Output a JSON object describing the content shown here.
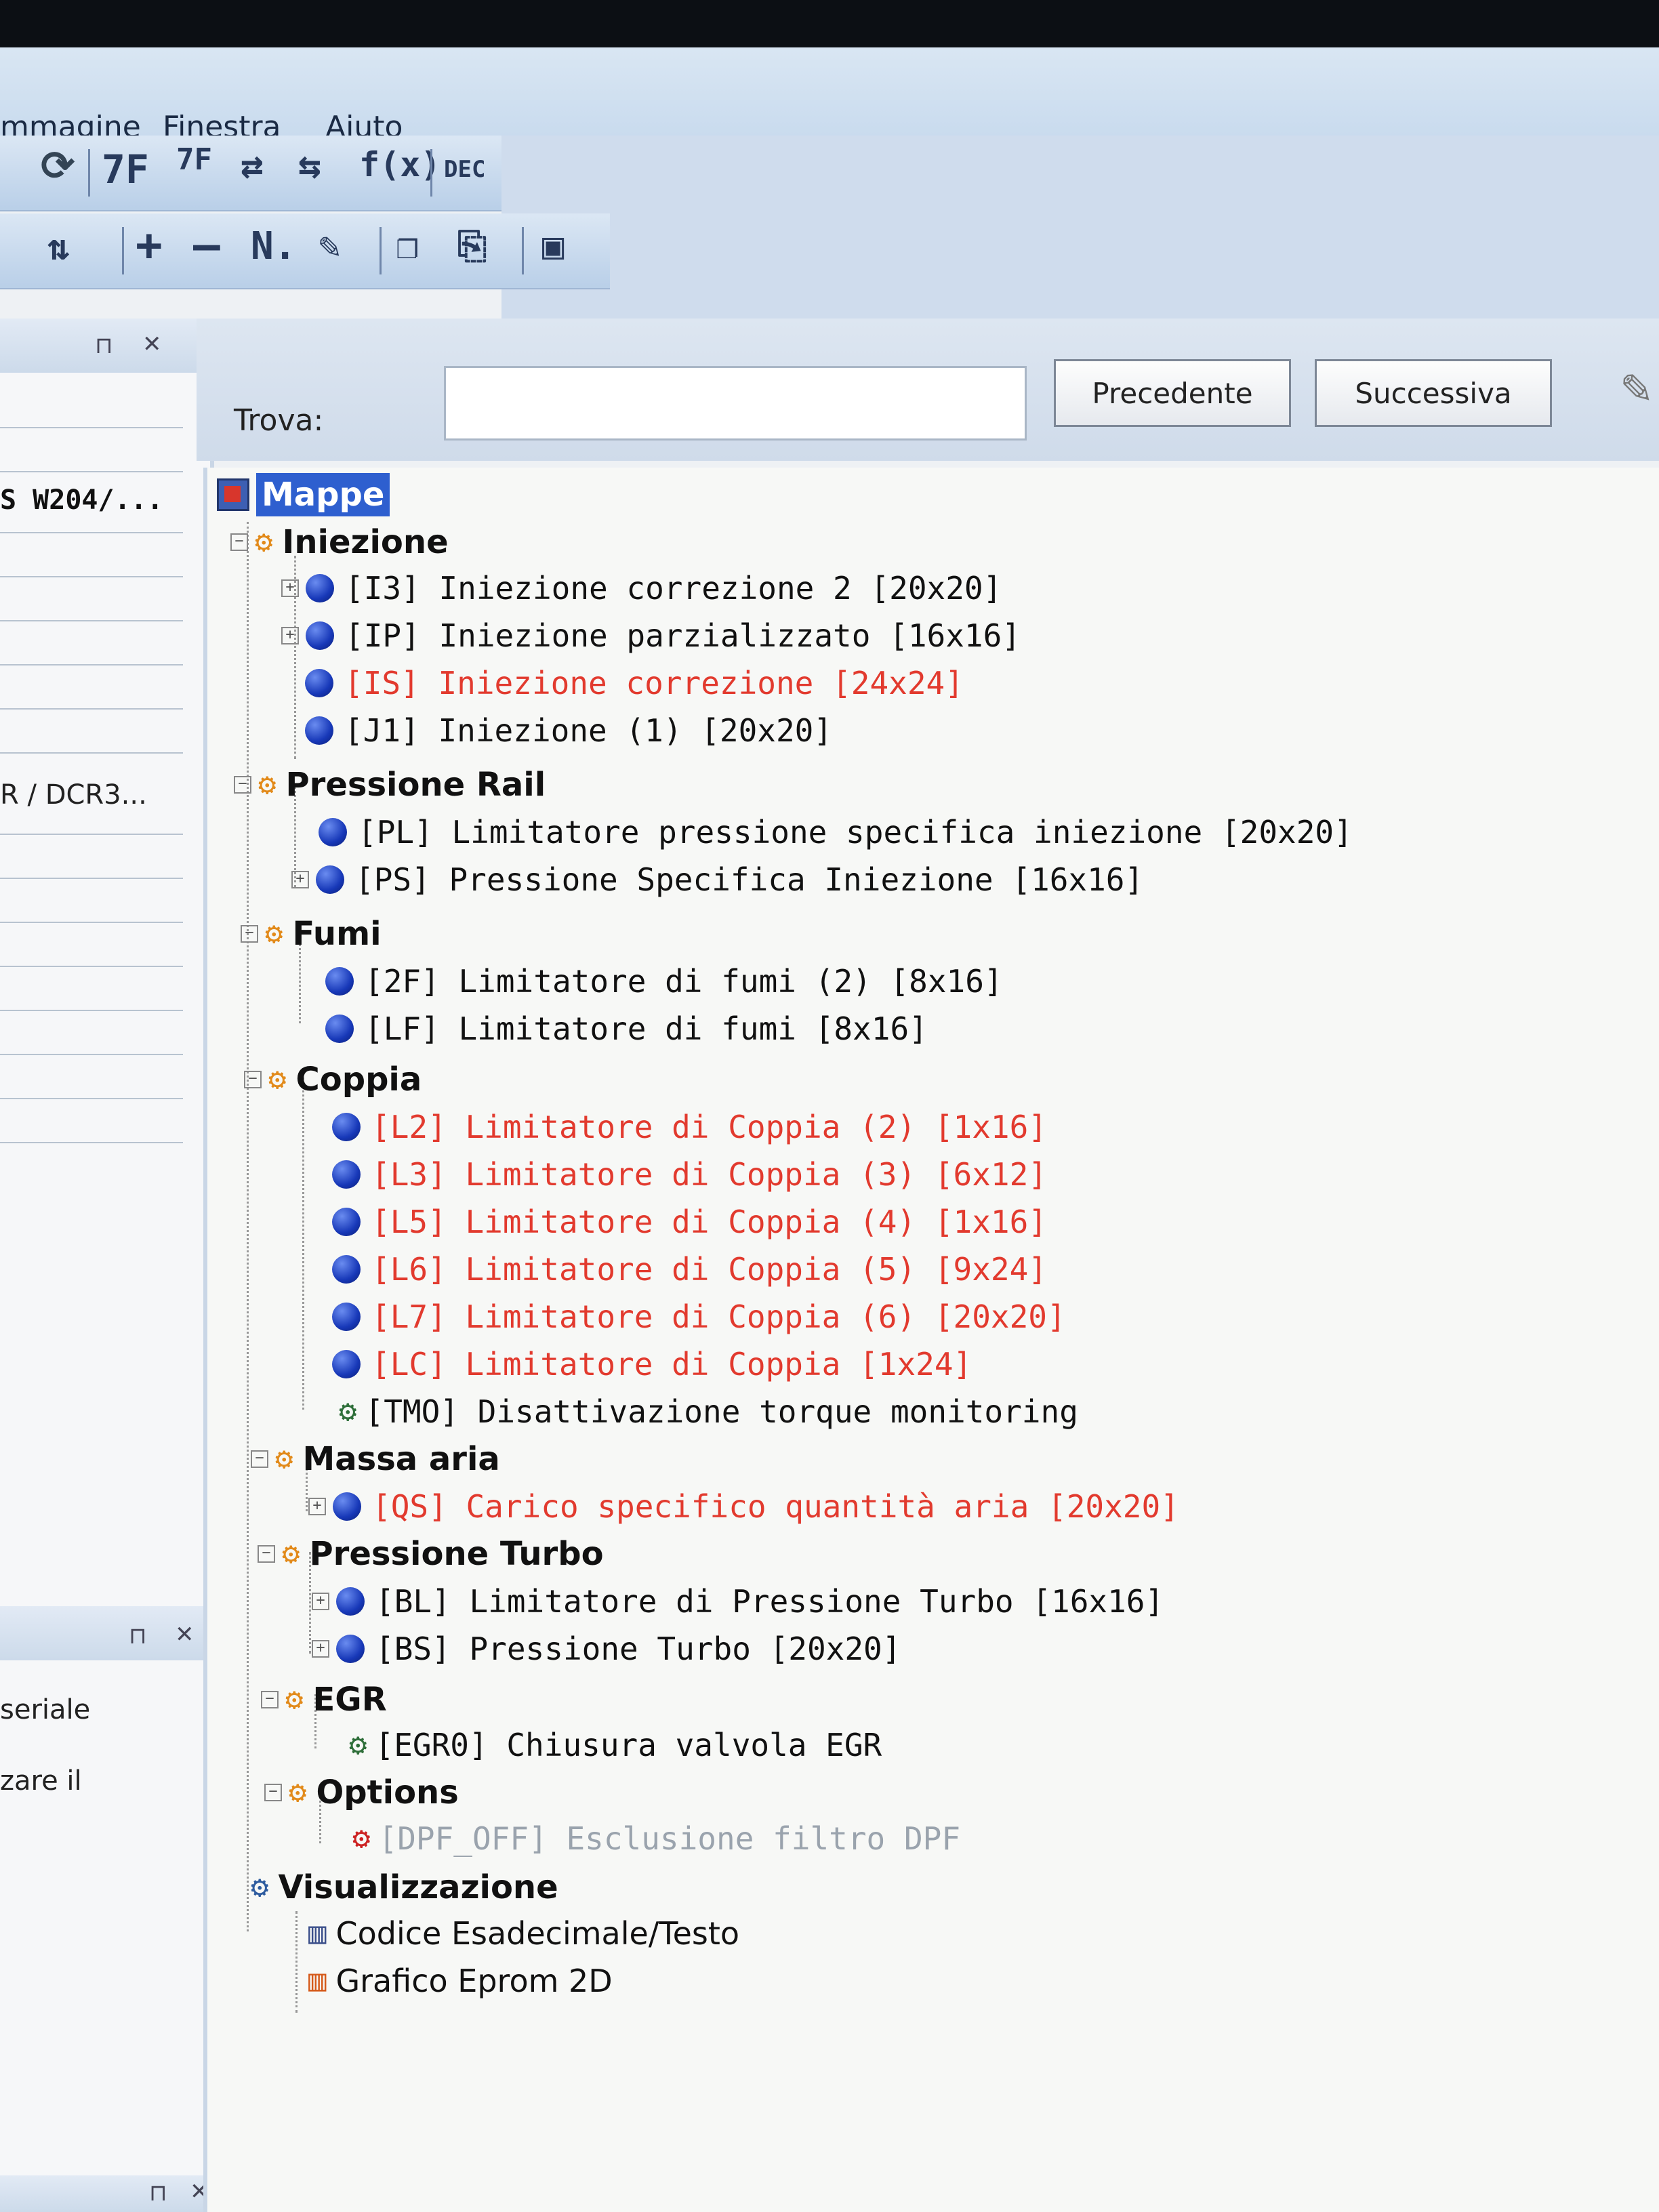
{
  "menu": {
    "items": [
      "mmagine",
      "Finestra",
      "Aiuto"
    ]
  },
  "toolbar1": {
    "labels": [
      "7F",
      "7F",
      "DEC"
    ]
  },
  "toolbar2": {
    "labels": [
      "+",
      "—",
      "N."
    ]
  },
  "left_panel": {
    "lines": [
      "S W204/...",
      "R / DCR3..."
    ],
    "bottom_text": [
      "seriale",
      "zare il"
    ]
  },
  "find": {
    "label": "Trova:",
    "input_value": "",
    "prev_button": "Precedente",
    "next_button": "Successiva"
  },
  "tree": {
    "root": "Mappe",
    "groups": [
      {
        "name": "Iniezione",
        "items": [
          {
            "label": "[I3] Iniezione correzione 2 [20x20]",
            "color": "black",
            "expandable": true
          },
          {
            "label": "[IP] Iniezione parzializzato [16x16]",
            "color": "black",
            "expandable": true
          },
          {
            "label": "[IS] Iniezione correzione [24x24]",
            "color": "red",
            "expandable": false
          },
          {
            "label": "[J1] Iniezione (1) [20x20]",
            "color": "black",
            "expandable": false
          }
        ]
      },
      {
        "name": "Pressione Rail",
        "items": [
          {
            "label": "[PL] Limitatore pressione specifica iniezione [20x20]",
            "color": "black",
            "expandable": false
          },
          {
            "label": "[PS] Pressione Specifica Iniezione [16x16]",
            "color": "black",
            "expandable": true
          }
        ]
      },
      {
        "name": "Fumi",
        "items": [
          {
            "label": "[2F] Limitatore di fumi (2) [8x16]",
            "color": "black",
            "expandable": false
          },
          {
            "label": "[LF] Limitatore di fumi [8x16]",
            "color": "black",
            "expandable": false
          }
        ]
      },
      {
        "name": "Coppia",
        "items": [
          {
            "label": "[L2] Limitatore di Coppia (2) [1x16]",
            "color": "red",
            "expandable": false
          },
          {
            "label": "[L3] Limitatore di Coppia (3) [6x12]",
            "color": "red",
            "expandable": false
          },
          {
            "label": "[L5] Limitatore di Coppia (4) [1x16]",
            "color": "red",
            "expandable": false
          },
          {
            "label": "[L6] Limitatore di Coppia (5) [9x24]",
            "color": "red",
            "expandable": false
          },
          {
            "label": "[L7] Limitatore di Coppia (6) [20x20]",
            "color": "red",
            "expandable": false
          },
          {
            "label": "[LC] Limitatore di Coppia [1x24]",
            "color": "red",
            "expandable": false
          },
          {
            "label": "[TMO] Disattivazione  torque monitoring",
            "color": "black",
            "expandable": false,
            "icon": "patch"
          }
        ]
      },
      {
        "name": "Massa aria",
        "items": [
          {
            "label": "[QS] Carico specifico quantità aria [20x20]",
            "color": "red",
            "expandable": true
          }
        ]
      },
      {
        "name": "Pressione Turbo",
        "items": [
          {
            "label": "[BL] Limitatore di Pressione Turbo [16x16]",
            "color": "black",
            "expandable": true
          },
          {
            "label": "[BS] Pressione Turbo [20x20]",
            "color": "black",
            "expandable": true
          }
        ]
      },
      {
        "name": "EGR",
        "items": [
          {
            "label": "[EGR0] Chiusura valvola EGR",
            "color": "black",
            "expandable": false,
            "icon": "patch"
          }
        ]
      },
      {
        "name": "Options",
        "items": [
          {
            "label": "[DPF_OFF] Esclusione filtro DPF",
            "color": "gray",
            "expandable": false,
            "icon": "patch-red"
          }
        ]
      }
    ],
    "visualizzazione": {
      "name": "Visualizzazione",
      "items": [
        "Codice Esadecimale/Testo",
        "Grafico Eprom 2D"
      ]
    }
  },
  "colors": {
    "red_item": "#e23a2e",
    "root_highlight": "#2e5fcf",
    "blue_dot": "#1738b8"
  }
}
